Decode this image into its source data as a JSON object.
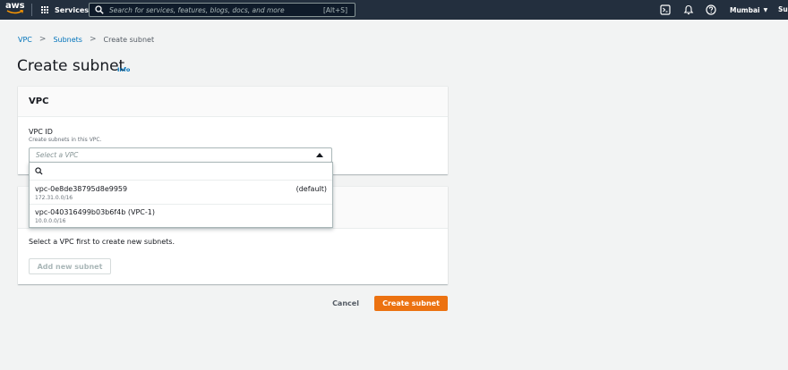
{
  "nav": {
    "logo": "aws",
    "services_label": "Services",
    "search_placeholder": "Search for services, features, blogs, docs, and more",
    "search_shortcut": "[Alt+S]",
    "region": "Mumbai",
    "user": "Sur"
  },
  "breadcrumb": {
    "items": [
      "VPC",
      "Subnets",
      "Create subnet"
    ]
  },
  "page": {
    "title": "Create subnet",
    "info": "Info"
  },
  "vpc_section": {
    "header": "VPC",
    "field_label": "VPC ID",
    "field_desc": "Create subnets in this VPC.",
    "select_placeholder": "Select a VPC"
  },
  "dropdown": {
    "options": [
      {
        "id": "vpc-0e8de38795d8e9959",
        "cidr": "172.31.0.0/16",
        "tag": "(default)"
      },
      {
        "id": "vpc-040316499b03b6f4b (VPC-1)",
        "cidr": "10.0.0.0/16",
        "tag": ""
      }
    ]
  },
  "subnet_section": {
    "message": "Select a VPC first to create new subnets.",
    "add_button": "Add new subnet"
  },
  "footer": {
    "cancel": "Cancel",
    "create": "Create subnet"
  },
  "colors": {
    "nav_bg": "#232f3e",
    "link": "#0073bb",
    "primary_button": "#ec7211"
  }
}
